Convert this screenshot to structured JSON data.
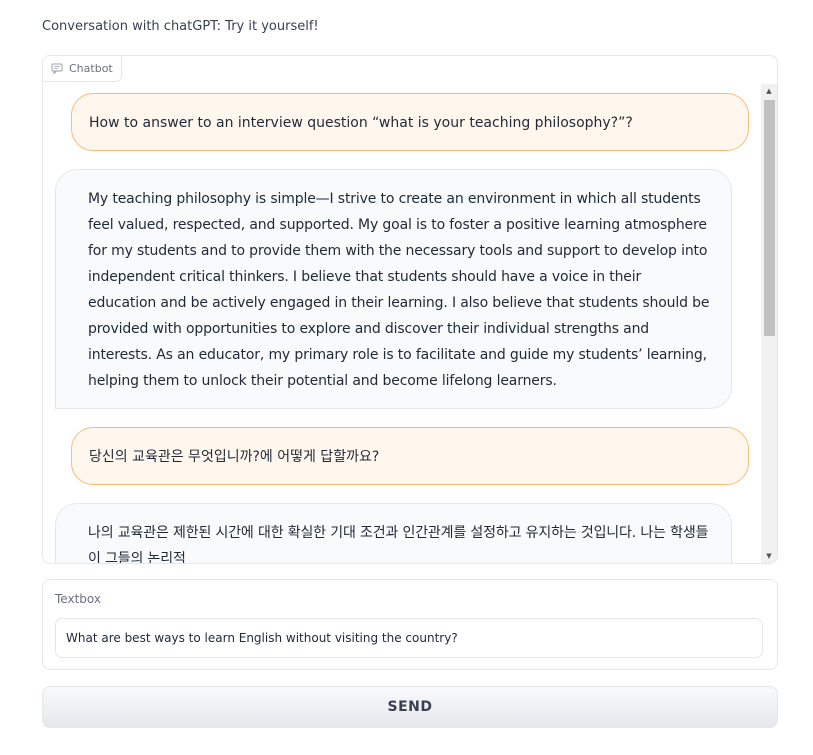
{
  "page": {
    "description": "Conversation with chatGPT: Try it yourself!"
  },
  "chatbot": {
    "label": "Chatbot",
    "messages": [
      {
        "role": "user",
        "text": "How to answer to an interview question “what is your teaching philosophy?”?"
      },
      {
        "role": "bot",
        "text": "My teaching philosophy is simple—I strive to create an environment in which all students feel valued, respected, and supported. My goal is to foster a positive learning atmosphere for my students and to provide them with the necessary tools and support to develop into independent critical thinkers. I believe that students should have a voice in their education and be actively engaged in their learning. I also believe that students should be provided with opportunities to explore and discover their individual strengths and interests. As an educator, my primary role is to facilitate and guide my students’ learning, helping them to unlock their potential and become lifelong learners."
      },
      {
        "role": "user",
        "text": "당신의 교육관은 무엇입니까?에 어떻게 답할까요?"
      },
      {
        "role": "bot",
        "text": "나의 교육관은 제한된 시간에 대한 확실한 기대 조건과 인간관계를 설정하고 유지하는 것입니다. 나는 학생들이 그들의 논리적"
      }
    ]
  },
  "textbox": {
    "label": "Textbox",
    "value": "What are best ways to learn English without visiting the country?"
  },
  "send": {
    "label": "SEND"
  },
  "icons": {
    "chat": "chat-bubble-icon",
    "scroll_up": "scroll-up-arrow-icon",
    "scroll_down": "scroll-down-arrow-icon"
  }
}
